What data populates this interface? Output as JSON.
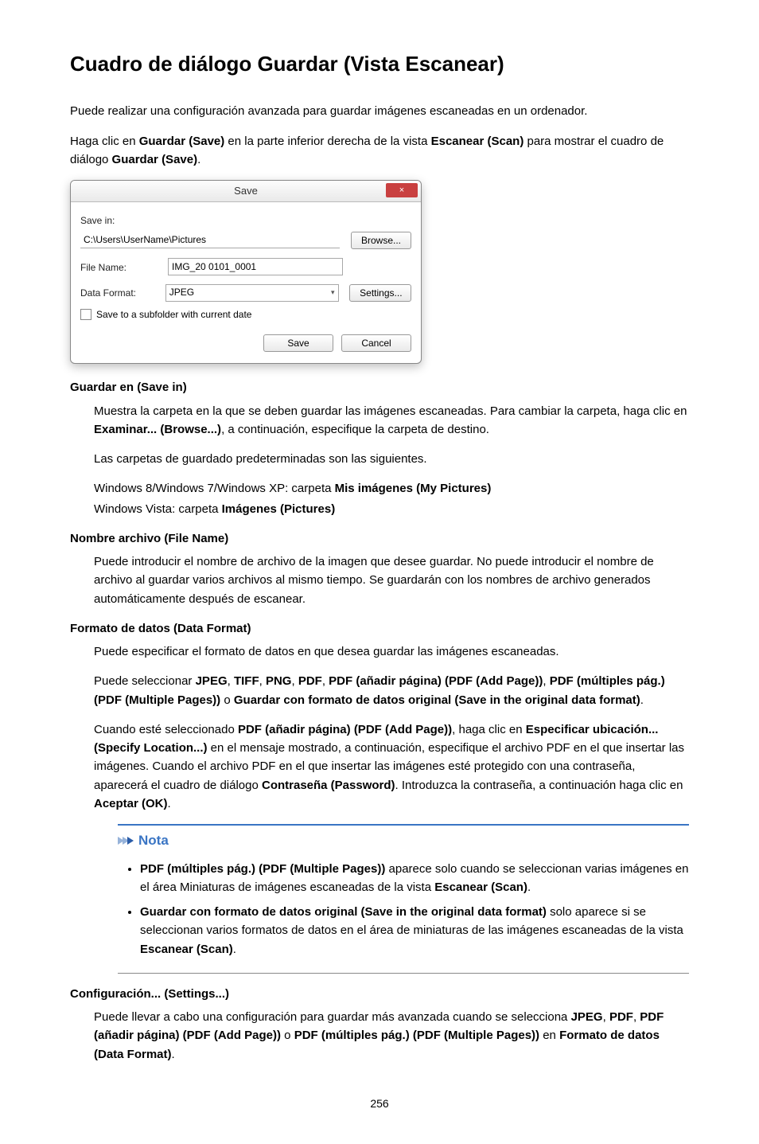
{
  "title": "Cuadro de diálogo Guardar (Vista Escanear)",
  "intro1": "Puede realizar una configuración avanzada para guardar imágenes escaneadas en un ordenador.",
  "intro2a": "Haga clic en ",
  "intro2b": "Guardar (Save)",
  "intro2c": " en la parte inferior derecha de la vista ",
  "intro2d": "Escanear (Scan)",
  "intro2e": " para mostrar el cuadro de diálogo ",
  "intro2f": "Guardar (Save)",
  "intro2g": ".",
  "dialog": {
    "title": "Save",
    "close": "×",
    "saveInLabel": "Save in:",
    "saveInValue": "C:\\Users\\UserName\\Pictures",
    "browse": "Browse...",
    "fileNameLabel": "File Name:",
    "fileNameValue": "IMG_20    0101_0001",
    "dataFormatLabel": "Data Format:",
    "dataFormatValue": "JPEG",
    "settings": "Settings...",
    "subfolder": "Save to a subfolder with current date",
    "saveBtn": "Save",
    "cancelBtn": "Cancel"
  },
  "sec1": {
    "dt": "Guardar en (Save in)",
    "p1": "Muestra la carpeta en la que se deben guardar las imágenes escaneadas. Para cambiar la carpeta, haga clic en ",
    "p1b": "Examinar... (Browse...)",
    "p1c": ", a continuación, especifique la carpeta de destino.",
    "p2": "Las carpetas de guardado predeterminadas son las siguientes.",
    "p3a": "Windows 8/Windows 7/Windows XP: carpeta ",
    "p3b": "Mis imágenes (My Pictures)",
    "p4a": "Windows Vista: carpeta ",
    "p4b": "Imágenes (Pictures)"
  },
  "sec2": {
    "dt": "Nombre archivo (File Name)",
    "p1": "Puede introducir el nombre de archivo de la imagen que desee guardar. No puede introducir el nombre de archivo al guardar varios archivos al mismo tiempo. Se guardarán con los nombres de archivo generados automáticamente después de escanear."
  },
  "sec3": {
    "dt": "Formato de datos (Data Format)",
    "p1": "Puede especificar el formato de datos en que desea guardar las imágenes escaneadas.",
    "p2a": "Puede seleccionar ",
    "p2_jpeg": "JPEG",
    "p2_tiff": "TIFF",
    "p2_png": "PNG",
    "p2_pdf": "PDF",
    "p2_pdfadd": "PDF (añadir página) (PDF (Add Page))",
    "p2_pdfmult": "PDF (múltiples pág.) (PDF (Multiple Pages))",
    "p2_or": " o ",
    "p2_orig": "Guardar con formato de datos original (Save in the original data format)",
    "p3a": "Cuando esté seleccionado ",
    "p3b": "PDF (añadir página) (PDF (Add Page))",
    "p3c": ", haga clic en ",
    "p3d": "Especificar ubicación... (Specify Location...)",
    "p3e": " en el mensaje mostrado, a continuación, especifique el archivo PDF en el que insertar las imágenes. Cuando el archivo PDF en el que insertar las imágenes esté protegido con una contraseña, aparecerá el cuadro de diálogo ",
    "p3f": "Contraseña (Password)",
    "p3g": ". Introduzca la contraseña, a continuación haga clic en ",
    "p3h": "Aceptar (OK)",
    "p3i": "."
  },
  "note": {
    "title": "Nota",
    "li1a": "PDF (múltiples pág.) (PDF (Multiple Pages))",
    "li1b": " aparece solo cuando se seleccionan varias imágenes en el área Miniaturas de imágenes escaneadas de la vista ",
    "li1c": "Escanear (Scan)",
    "li1d": ".",
    "li2a": "Guardar con formato de datos original (Save in the original data format)",
    "li2b": " solo aparece si se seleccionan varios formatos de datos en el área de miniaturas de las imágenes escaneadas de la vista ",
    "li2c": "Escanear (Scan)",
    "li2d": "."
  },
  "sec4": {
    "dt": "Configuración... (Settings...)",
    "p1a": "Puede llevar a cabo una configuración para guardar más avanzada cuando se selecciona ",
    "p1b": "JPEG",
    "p1c": "PDF",
    "p1d": "PDF (añadir página) (PDF (Add Page))",
    "p1e": "PDF (múltiples pág.) (PDF (Multiple Pages))",
    "p1f": " en ",
    "p1g": "Formato de datos (Data Format)",
    "p1h": "."
  },
  "pageNumber": "256"
}
